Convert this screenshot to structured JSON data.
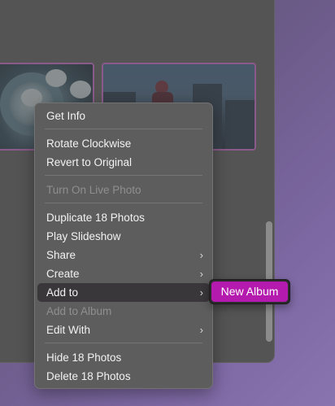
{
  "context_menu": {
    "items": [
      {
        "label": "Get Info",
        "enabled": true
      },
      {
        "label": "Rotate Clockwise",
        "enabled": true
      },
      {
        "label": "Revert to Original",
        "enabled": true
      },
      {
        "label": "Turn On Live Photo",
        "enabled": false
      },
      {
        "label": "Duplicate 18 Photos",
        "enabled": true
      },
      {
        "label": "Play Slideshow",
        "enabled": true
      },
      {
        "label": "Share",
        "enabled": true,
        "submenu": true
      },
      {
        "label": "Create",
        "enabled": true,
        "submenu": true
      },
      {
        "label": "Add to",
        "enabled": true,
        "submenu": true,
        "highlighted": true
      },
      {
        "label": "Add to Album",
        "enabled": false
      },
      {
        "label": "Edit With",
        "enabled": true,
        "submenu": true
      },
      {
        "label": "Hide 18 Photos",
        "enabled": true
      },
      {
        "label": "Delete 18 Photos",
        "enabled": true
      }
    ],
    "chevron": "›"
  },
  "submenu": {
    "items": [
      {
        "label": "New Album",
        "selected": true
      }
    ]
  },
  "colors": {
    "selection_accent": "#b31aad",
    "photo_selection_border": "#8a5a8a"
  },
  "icons": [
    "chevron-right-icon"
  ]
}
